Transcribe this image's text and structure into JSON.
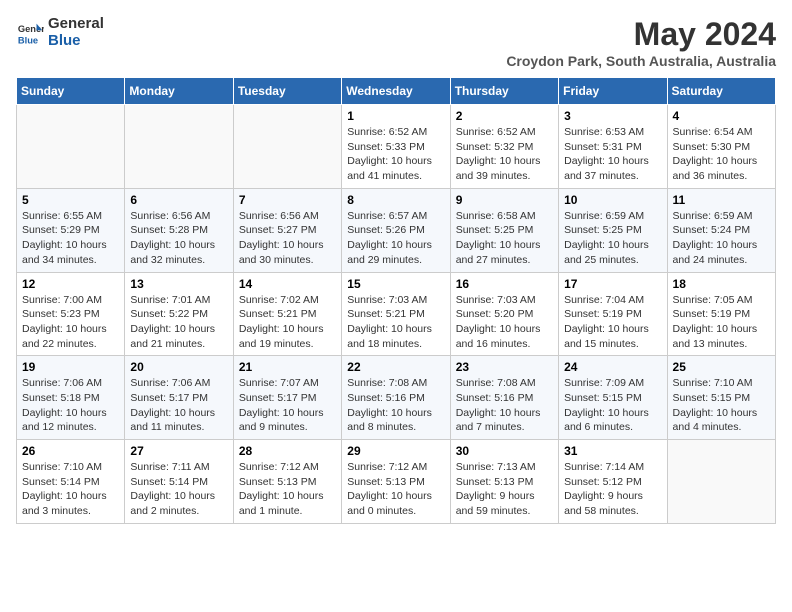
{
  "header": {
    "logo_line1": "General",
    "logo_line2": "Blue",
    "month_title": "May 2024",
    "location": "Croydon Park, South Australia, Australia"
  },
  "weekdays": [
    "Sunday",
    "Monday",
    "Tuesday",
    "Wednesday",
    "Thursday",
    "Friday",
    "Saturday"
  ],
  "weeks": [
    [
      {
        "day": "",
        "info": ""
      },
      {
        "day": "",
        "info": ""
      },
      {
        "day": "",
        "info": ""
      },
      {
        "day": "1",
        "info": "Sunrise: 6:52 AM\nSunset: 5:33 PM\nDaylight: 10 hours\nand 41 minutes."
      },
      {
        "day": "2",
        "info": "Sunrise: 6:52 AM\nSunset: 5:32 PM\nDaylight: 10 hours\nand 39 minutes."
      },
      {
        "day": "3",
        "info": "Sunrise: 6:53 AM\nSunset: 5:31 PM\nDaylight: 10 hours\nand 37 minutes."
      },
      {
        "day": "4",
        "info": "Sunrise: 6:54 AM\nSunset: 5:30 PM\nDaylight: 10 hours\nand 36 minutes."
      }
    ],
    [
      {
        "day": "5",
        "info": "Sunrise: 6:55 AM\nSunset: 5:29 PM\nDaylight: 10 hours\nand 34 minutes."
      },
      {
        "day": "6",
        "info": "Sunrise: 6:56 AM\nSunset: 5:28 PM\nDaylight: 10 hours\nand 32 minutes."
      },
      {
        "day": "7",
        "info": "Sunrise: 6:56 AM\nSunset: 5:27 PM\nDaylight: 10 hours\nand 30 minutes."
      },
      {
        "day": "8",
        "info": "Sunrise: 6:57 AM\nSunset: 5:26 PM\nDaylight: 10 hours\nand 29 minutes."
      },
      {
        "day": "9",
        "info": "Sunrise: 6:58 AM\nSunset: 5:25 PM\nDaylight: 10 hours\nand 27 minutes."
      },
      {
        "day": "10",
        "info": "Sunrise: 6:59 AM\nSunset: 5:25 PM\nDaylight: 10 hours\nand 25 minutes."
      },
      {
        "day": "11",
        "info": "Sunrise: 6:59 AM\nSunset: 5:24 PM\nDaylight: 10 hours\nand 24 minutes."
      }
    ],
    [
      {
        "day": "12",
        "info": "Sunrise: 7:00 AM\nSunset: 5:23 PM\nDaylight: 10 hours\nand 22 minutes."
      },
      {
        "day": "13",
        "info": "Sunrise: 7:01 AM\nSunset: 5:22 PM\nDaylight: 10 hours\nand 21 minutes."
      },
      {
        "day": "14",
        "info": "Sunrise: 7:02 AM\nSunset: 5:21 PM\nDaylight: 10 hours\nand 19 minutes."
      },
      {
        "day": "15",
        "info": "Sunrise: 7:03 AM\nSunset: 5:21 PM\nDaylight: 10 hours\nand 18 minutes."
      },
      {
        "day": "16",
        "info": "Sunrise: 7:03 AM\nSunset: 5:20 PM\nDaylight: 10 hours\nand 16 minutes."
      },
      {
        "day": "17",
        "info": "Sunrise: 7:04 AM\nSunset: 5:19 PM\nDaylight: 10 hours\nand 15 minutes."
      },
      {
        "day": "18",
        "info": "Sunrise: 7:05 AM\nSunset: 5:19 PM\nDaylight: 10 hours\nand 13 minutes."
      }
    ],
    [
      {
        "day": "19",
        "info": "Sunrise: 7:06 AM\nSunset: 5:18 PM\nDaylight: 10 hours\nand 12 minutes."
      },
      {
        "day": "20",
        "info": "Sunrise: 7:06 AM\nSunset: 5:17 PM\nDaylight: 10 hours\nand 11 minutes."
      },
      {
        "day": "21",
        "info": "Sunrise: 7:07 AM\nSunset: 5:17 PM\nDaylight: 10 hours\nand 9 minutes."
      },
      {
        "day": "22",
        "info": "Sunrise: 7:08 AM\nSunset: 5:16 PM\nDaylight: 10 hours\nand 8 minutes."
      },
      {
        "day": "23",
        "info": "Sunrise: 7:08 AM\nSunset: 5:16 PM\nDaylight: 10 hours\nand 7 minutes."
      },
      {
        "day": "24",
        "info": "Sunrise: 7:09 AM\nSunset: 5:15 PM\nDaylight: 10 hours\nand 6 minutes."
      },
      {
        "day": "25",
        "info": "Sunrise: 7:10 AM\nSunset: 5:15 PM\nDaylight: 10 hours\nand 4 minutes."
      }
    ],
    [
      {
        "day": "26",
        "info": "Sunrise: 7:10 AM\nSunset: 5:14 PM\nDaylight: 10 hours\nand 3 minutes."
      },
      {
        "day": "27",
        "info": "Sunrise: 7:11 AM\nSunset: 5:14 PM\nDaylight: 10 hours\nand 2 minutes."
      },
      {
        "day": "28",
        "info": "Sunrise: 7:12 AM\nSunset: 5:13 PM\nDaylight: 10 hours\nand 1 minute."
      },
      {
        "day": "29",
        "info": "Sunrise: 7:12 AM\nSunset: 5:13 PM\nDaylight: 10 hours\nand 0 minutes."
      },
      {
        "day": "30",
        "info": "Sunrise: 7:13 AM\nSunset: 5:13 PM\nDaylight: 9 hours\nand 59 minutes."
      },
      {
        "day": "31",
        "info": "Sunrise: 7:14 AM\nSunset: 5:12 PM\nDaylight: 9 hours\nand 58 minutes."
      },
      {
        "day": "",
        "info": ""
      }
    ]
  ]
}
